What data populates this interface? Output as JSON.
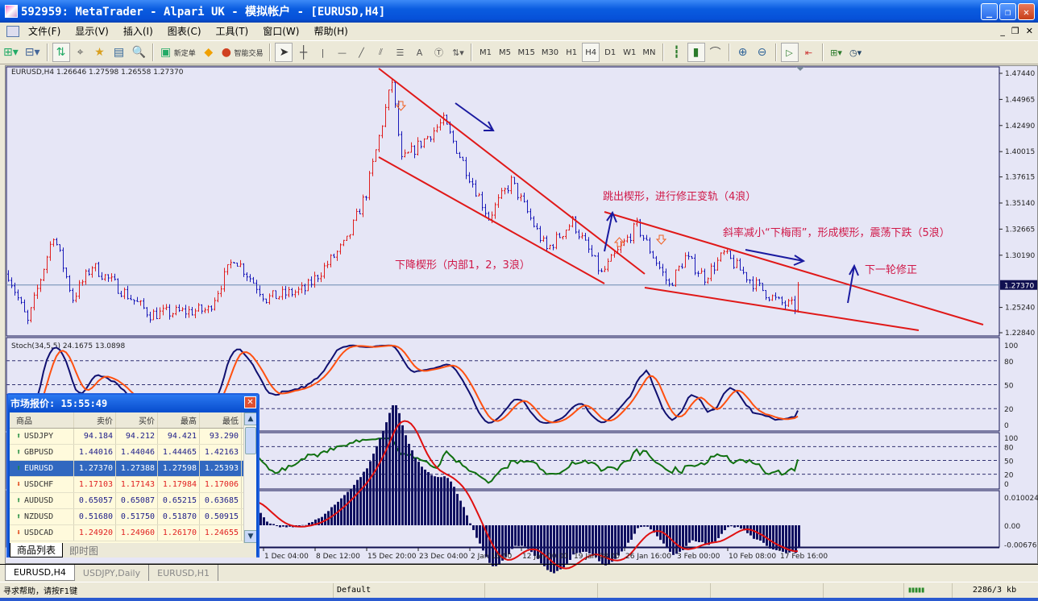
{
  "window": {
    "title": "592959: MetaTrader - Alpari UK - 模拟帐户 - [EURUSD,H4]"
  },
  "menu": [
    "文件(F)",
    "显示(V)",
    "插入(I)",
    "图表(C)",
    "工具(T)",
    "窗口(W)",
    "帮助(H)"
  ],
  "toolbar": {
    "new_order": "新定单",
    "expert": "智能交易",
    "timeframes": [
      "M1",
      "M5",
      "M15",
      "M30",
      "H1",
      "H4",
      "D1",
      "W1",
      "MN"
    ],
    "active_timeframe": "H4",
    "text_tool": "A"
  },
  "chart": {
    "info": "EURUSD,H4  1.26646 1.27598 1.26558 1.27370",
    "current_price": "1.27370",
    "price_axis": [
      "1.47440",
      "1.44965",
      "1.42490",
      "1.40015",
      "1.37615",
      "1.35140",
      "1.32665",
      "1.30190",
      "1.25240",
      "1.22840"
    ],
    "stoch_label": "Stoch(34,5,5) 24.1675 13.0898",
    "stoch_axis": [
      "100",
      "80",
      "50",
      "20",
      "0"
    ],
    "osc_axis": [
      "100",
      "80",
      "50",
      "20",
      "0"
    ],
    "macd_axis": [
      "0.010024",
      "0.00",
      "-0.00676"
    ],
    "time_axis": [
      "1 Dec 04:00",
      "8 Dec 12:00",
      "15 Dec 20:00",
      "23 Dec 04:00",
      "2 Jan 16:00",
      "12 Jan 00:00",
      "19 Jan 08:00",
      "26 Jan 16:00",
      "3 Feb 00:00",
      "10 Feb 08:00",
      "17 Feb 16:00"
    ],
    "annotations": {
      "wave4": "跳出楔形，进行修正变轨（4浪）",
      "wave5": "斜率减小“下梅雨”，形成楔形，震荡下跌（5浪）",
      "wave123": "下降楔形（内部1，2，3浪）",
      "next": "下一轮修正"
    },
    "colors": {
      "up": "#e02020",
      "down": "#1a1ab8",
      "trendline": "#e01818",
      "arrow": "#1a1aa0",
      "stoch_main": "#101070",
      "stoch_signal": "#ff5010",
      "osc": "#107010",
      "macd_hist": "#101060",
      "macd_signal": "#e01010",
      "annotation": "#d01848"
    }
  },
  "chart_data": {
    "type": "candlestick",
    "symbol": "EURUSD",
    "timeframe": "H4",
    "ylim": [
      1.2284,
      1.4744
    ],
    "price_path": [
      [
        0,
        1.284
      ],
      [
        6,
        1.238
      ],
      [
        14,
        1.322
      ],
      [
        20,
        1.261
      ],
      [
        26,
        1.292
      ],
      [
        44,
        1.246
      ],
      [
        62,
        1.25
      ],
      [
        70,
        1.3
      ],
      [
        80,
        1.261
      ],
      [
        92,
        1.269
      ],
      [
        105,
        1.315
      ],
      [
        111,
        1.361
      ],
      [
        115,
        1.414
      ],
      [
        119,
        1.467
      ],
      [
        122,
        1.391
      ],
      [
        135,
        1.429
      ],
      [
        149,
        1.338
      ],
      [
        156,
        1.372
      ],
      [
        167,
        1.307
      ],
      [
        175,
        1.334
      ],
      [
        184,
        1.284
      ],
      [
        195,
        1.33
      ],
      [
        205,
        1.273
      ],
      [
        210,
        1.3
      ],
      [
        216,
        1.281
      ],
      [
        222,
        1.303
      ],
      [
        231,
        1.276
      ],
      [
        239,
        1.257
      ],
      [
        244,
        1.253
      ],
      [
        245,
        1.2737
      ]
    ]
  },
  "market_watch": {
    "title": "市场报价: 15:55:49",
    "columns": [
      "商品",
      "卖价",
      "买价",
      "最高",
      "最低"
    ],
    "rows": [
      {
        "symbol": "USDJPY",
        "bid": "94.184",
        "ask": "94.212",
        "high": "94.421",
        "low": "93.290",
        "dir": "up",
        "selected": false
      },
      {
        "symbol": "GBPUSD",
        "bid": "1.44016",
        "ask": "1.44046",
        "high": "1.44465",
        "low": "1.42163",
        "dir": "up",
        "selected": false
      },
      {
        "symbol": "EURUSD",
        "bid": "1.27370",
        "ask": "1.27388",
        "high": "1.27598",
        "low": "1.25393",
        "dir": "up",
        "selected": true
      },
      {
        "symbol": "USDCHF",
        "bid": "1.17103",
        "ask": "1.17143",
        "high": "1.17984",
        "low": "1.17006",
        "dir": "down",
        "selected": false
      },
      {
        "symbol": "AUDUSD",
        "bid": "0.65057",
        "ask": "0.65087",
        "high": "0.65215",
        "low": "0.63685",
        "dir": "up",
        "selected": false
      },
      {
        "symbol": "NZDUSD",
        "bid": "0.51680",
        "ask": "0.51750",
        "high": "0.51870",
        "low": "0.50915",
        "dir": "up",
        "selected": false
      },
      {
        "symbol": "USDCAD",
        "bid": "1.24920",
        "ask": "1.24960",
        "high": "1.26170",
        "low": "1.24655",
        "dir": "down",
        "selected": false
      }
    ],
    "tabs": [
      "商品列表",
      "即时图"
    ]
  },
  "chart_tabs": [
    "EURUSD,H4",
    "USDJPY,Daily",
    "EURUSD,H1"
  ],
  "status": {
    "help": "寻求帮助，请按F1键",
    "profile": "Default",
    "traffic": "2286/3 kb"
  }
}
